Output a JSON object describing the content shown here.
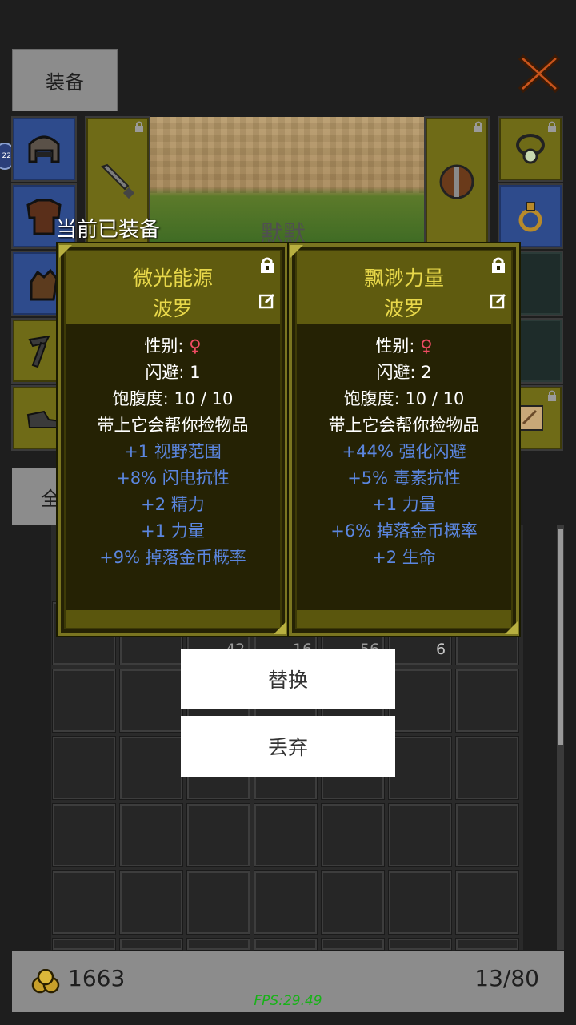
{
  "header": {
    "tab_equip": "装备",
    "tab_all_partial": "全"
  },
  "hero": {
    "name": "默默",
    "badge": "22"
  },
  "equipped_title": "当前已装备",
  "cards": [
    {
      "name": "微光能源",
      "owner": "波罗",
      "gender_label": "性别: ",
      "gender_symbol": "♀",
      "lines_white": [
        "闪避: 1",
        "饱腹度: 10 / 10",
        "带上它会帮你捡物品"
      ],
      "lines_blue": [
        "+1 视野范围",
        "+8% 闪电抗性",
        "+2 精力",
        "+1 力量",
        "+9% 掉落金币概率"
      ]
    },
    {
      "name": "飘渺力量",
      "owner": "波罗",
      "gender_label": "性别: ",
      "gender_symbol": "♀",
      "lines_white": [
        "闪避: 2",
        "饱腹度: 10 / 10",
        "带上它会帮你捡物品"
      ],
      "lines_blue": [
        "+44% 强化闪避",
        "+5% 毒素抗性",
        "+1 力量",
        "+6% 掉落金币概率",
        "+2 生命"
      ]
    }
  ],
  "menu": {
    "replace": "替换",
    "discard": "丢弃"
  },
  "inventory": {
    "visible_quantities": [
      "42",
      "16",
      "56",
      "6"
    ]
  },
  "footer": {
    "gold": "1663",
    "capacity": "13/80",
    "fps": "FPS:29.49"
  },
  "colors": {
    "card_title": "#e8d84a",
    "stat_blue": "#5b86df",
    "gender_pink": "#ef4b63",
    "fps_green": "#18b218"
  }
}
